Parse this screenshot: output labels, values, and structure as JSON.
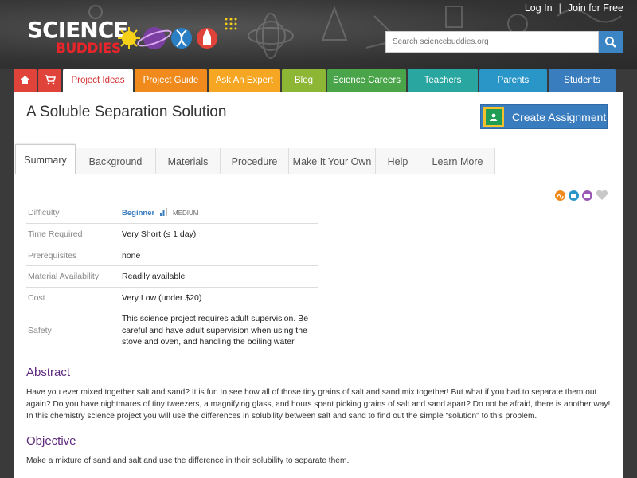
{
  "header": {
    "login": "Log In",
    "separator": "|",
    "join": "Join for Free",
    "logo_line1": "SCIENCE",
    "logo_line2": "BUDDIES",
    "search_placeholder": "Search sciencebuddies.org"
  },
  "nav": {
    "home_icon": "home-icon",
    "cart_icon": "cart-icon",
    "tabs": [
      {
        "label": "Project Ideas",
        "color": "#ffffff"
      },
      {
        "label": "Project Guide",
        "color": "#f08a1c"
      },
      {
        "label": "Ask An Expert",
        "color": "#f5a623"
      },
      {
        "label": "Blog",
        "color": "#8db634"
      },
      {
        "label": "Science Careers",
        "color": "#4aa54a"
      },
      {
        "label": "Teachers",
        "color": "#2aa6a0"
      },
      {
        "label": "Parents",
        "color": "#2a96c8"
      },
      {
        "label": "Students",
        "color": "#3a7dbf"
      }
    ],
    "home_color": "#e0433a",
    "cart_color": "#e0433a"
  },
  "page": {
    "title": "A Soluble Separation Solution",
    "create_assignment": "Create Assignment"
  },
  "subtabs": [
    "Summary",
    "Background",
    "Materials",
    "Procedure",
    "Make It Your Own",
    "Help",
    "Learn More"
  ],
  "facts": [
    {
      "label": "Difficulty",
      "value": "Beginner",
      "extra": "MEDIUM"
    },
    {
      "label": "Time Required",
      "value": "Very Short (≤ 1 day)"
    },
    {
      "label": "Prerequisites",
      "value": "none"
    },
    {
      "label": "Material Availability",
      "value": "Readily available"
    },
    {
      "label": "Cost",
      "value": "Very Low (under $20)"
    },
    {
      "label": "Safety",
      "value": "This science project requires adult supervision. Be careful and have adult supervision when using the stove and oven, and handling the boiling water"
    }
  ],
  "abstract": {
    "heading": "Abstract",
    "text": "Have you ever mixed together salt and sand? It is fun to see how all of those tiny grains of salt and sand mix together! But what if you had to separate them out again? Do you have nightmares of tiny tweezers, a magnifying glass, and hours spent picking grains of salt and sand apart? Do not be afraid, there is another way! In this chemistry science project you will use the differences in solubility between salt and sand to find out the simple \"solution\" to this problem."
  },
  "objective": {
    "heading": "Objective",
    "text": "Make a mixture of sand and salt and use the difference in their solubility to separate them."
  }
}
